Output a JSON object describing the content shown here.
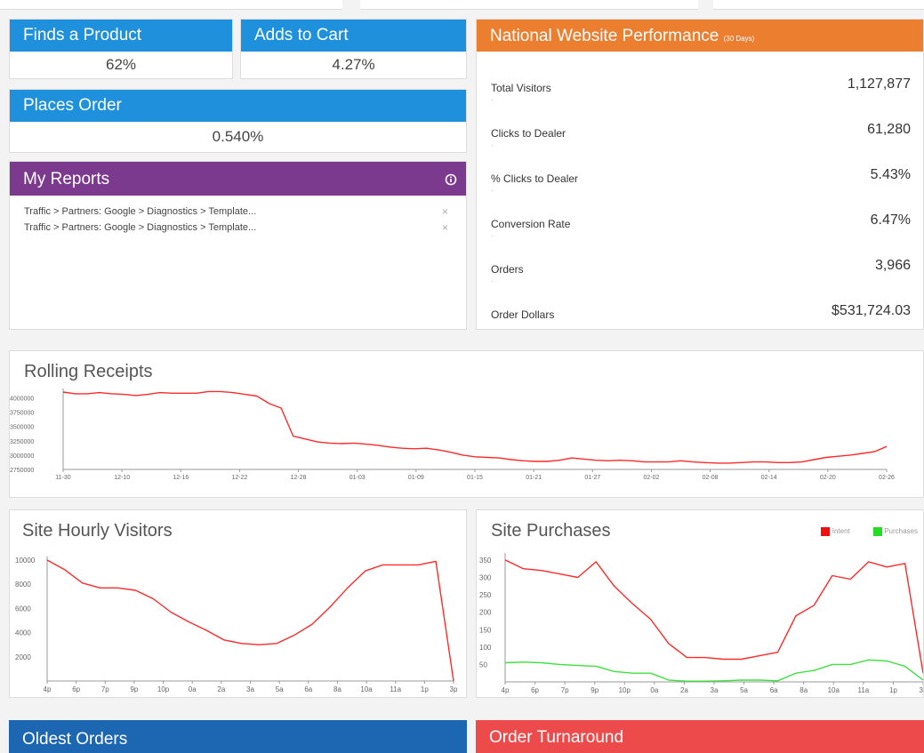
{
  "kpi": {
    "finds_product": {
      "label": "Finds a Product",
      "value": "62%"
    },
    "adds_to_cart": {
      "label": "Adds to Cart",
      "value": "4.27%"
    },
    "places_order": {
      "label": "Places Order",
      "value": "0.540%"
    }
  },
  "reports": {
    "title": "My Reports",
    "items": [
      "Traffic > Partners: Google > Diagnostics > Template...",
      "Traffic > Partners: Google > Diagnostics > Template..."
    ]
  },
  "national": {
    "title": "National Website Performance",
    "subtitle": "(30 Days)",
    "stats": [
      {
        "label": "Total Visitors",
        "value": "1,127,877"
      },
      {
        "label": "Clicks to Dealer",
        "value": "61,280"
      },
      {
        "label": "% Clicks to Dealer",
        "value": "5.43%"
      },
      {
        "label": "Conversion Rate",
        "value": "6.47%"
      },
      {
        "label": "Orders",
        "value": "3,966"
      },
      {
        "label": "Order Dollars",
        "value": "$531,724.03"
      }
    ]
  },
  "bottom": {
    "oldest_orders": "Oldest Orders",
    "order_turnaround": "Order Turnaround"
  },
  "colors": {
    "red_line": "#ff2a2a",
    "green_line": "#40e040"
  },
  "chart_data": [
    {
      "type": "line",
      "title": "Rolling Receipts",
      "x_ticks": [
        "11-30",
        "12-10",
        "12-16",
        "12-22",
        "12-28",
        "01-03",
        "01-09",
        "01-15",
        "01-21",
        "01-27",
        "02-02",
        "02-08",
        "02-14",
        "02-20",
        "02-26"
      ],
      "y_ticks": [
        "4000000",
        "3750000",
        "3500000",
        "3250000",
        "3000000",
        "2750000"
      ],
      "ylim": [
        2750000,
        4100000
      ],
      "series": [
        {
          "values": [
            4100000,
            4070000,
            4070000,
            4090000,
            4070000,
            4060000,
            4040000,
            4060000,
            4090000,
            4080000,
            4080000,
            4080000,
            4110000,
            4110000,
            4090000,
            4060000,
            4030000,
            3900000,
            3820000,
            3330000,
            3280000,
            3230000,
            3210000,
            3200000,
            3210000,
            3190000,
            3170000,
            3140000,
            3120000,
            3110000,
            3120000,
            3090000,
            3050000,
            3000000,
            2970000,
            2960000,
            2950000,
            2920000,
            2900000,
            2890000,
            2890000,
            2910000,
            2950000,
            2930000,
            2910000,
            2900000,
            2910000,
            2900000,
            2880000,
            2880000,
            2880000,
            2900000,
            2880000,
            2870000,
            2860000,
            2860000,
            2870000,
            2880000,
            2880000,
            2870000,
            2870000,
            2880000,
            2920000,
            2960000,
            2980000,
            3000000,
            3030000,
            3060000,
            3150000
          ]
        }
      ]
    },
    {
      "type": "line",
      "title": "Site Hourly Visitors",
      "categories": [
        "4p",
        "6p",
        "7p",
        "9p",
        "10p",
        "0a",
        "2a",
        "3a",
        "5a",
        "6a",
        "8a",
        "10a",
        "11a",
        "1p",
        "3p"
      ],
      "y_ticks": [
        "10000",
        "8000",
        "6000",
        "4000",
        "2000"
      ],
      "ylim": [
        0,
        10000
      ],
      "series": [
        {
          "values": [
            10000,
            9200,
            8100,
            7700,
            7700,
            7500,
            6800,
            5700,
            4900,
            4200,
            3400,
            3100,
            3000,
            3100,
            3800,
            4700,
            6100,
            7700,
            9100,
            9600,
            9600,
            9600,
            9900,
            0
          ]
        }
      ]
    },
    {
      "type": "line",
      "title": "Site Purchases",
      "categories": [
        "4p",
        "6p",
        "7p",
        "9p",
        "10p",
        "0a",
        "2a",
        "3a",
        "5a",
        "6a",
        "8a",
        "10a",
        "11a",
        "1p",
        "3p"
      ],
      "y_ticks": [
        "350",
        "300",
        "250",
        "200",
        "150",
        "100",
        "50"
      ],
      "ylim": [
        0,
        360
      ],
      "legend": {
        "position": "top-right",
        "entries": [
          "Intent",
          "Purchases"
        ]
      },
      "series": [
        {
          "name": "Intent",
          "values": [
            350,
            325,
            320,
            310,
            300,
            345,
            275,
            225,
            180,
            110,
            70,
            70,
            65,
            65,
            75,
            85,
            190,
            220,
            305,
            295,
            345,
            330,
            340,
            25
          ]
        },
        {
          "name": "Purchases",
          "values": [
            55,
            57,
            55,
            50,
            47,
            45,
            30,
            25,
            25,
            5,
            2,
            2,
            3,
            5,
            5,
            3,
            25,
            33,
            50,
            50,
            63,
            60,
            45,
            5
          ]
        }
      ]
    }
  ]
}
